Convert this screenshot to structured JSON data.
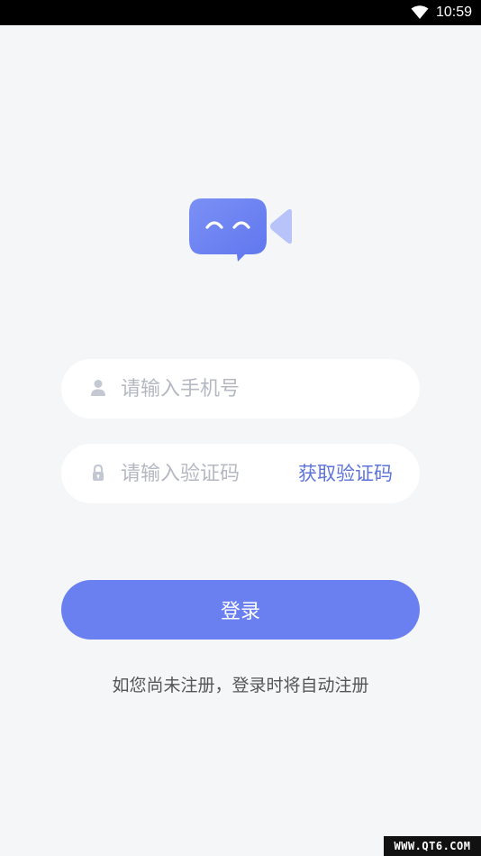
{
  "status_bar": {
    "time": "10:59",
    "wifi_icon": "wifi-icon"
  },
  "logo": {
    "icon": "video-chat-logo-icon",
    "colors": {
      "bubble": "#6e84f2",
      "triangle": "#b7c3f9"
    }
  },
  "form": {
    "phone": {
      "placeholder": "请输入手机号",
      "value": "",
      "icon": "user-icon"
    },
    "code": {
      "placeholder": "请输入验证码",
      "value": "",
      "icon": "lock-icon",
      "get_code_label": "获取验证码"
    }
  },
  "login_button": {
    "label": "登录",
    "color": "#6a7ff0"
  },
  "hint": "如您尚未注册，登录时将自动注册",
  "watermark": "WWW.QT6.COM",
  "colors": {
    "background": "#f5f6f8",
    "accent": "#5d73d9"
  }
}
